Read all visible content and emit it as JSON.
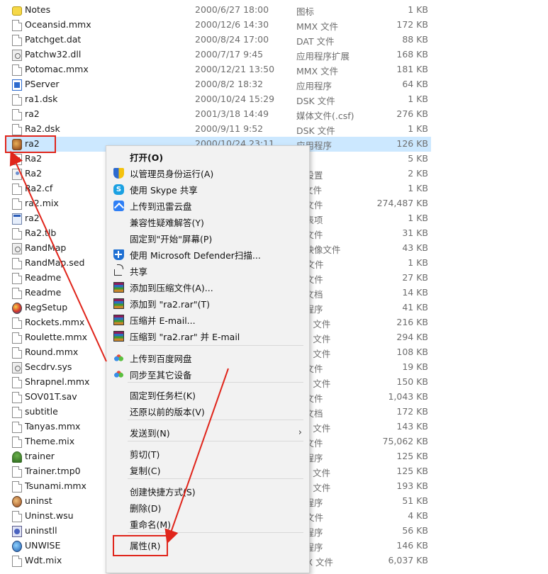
{
  "files": [
    {
      "name": "Notes",
      "date": "2000/6/27 18:00",
      "type": "图标",
      "size": "1 KB",
      "icon": "note-icon"
    },
    {
      "name": "Oceansid.mmx",
      "date": "2000/12/6 14:30",
      "type": "MMX 文件",
      "size": "172 KB",
      "icon": "file-icon"
    },
    {
      "name": "Patchget.dat",
      "date": "2000/8/24 17:00",
      "type": "DAT 文件",
      "size": "88 KB",
      "icon": "file-icon"
    },
    {
      "name": "Patchw32.dll",
      "date": "2000/7/17 9:45",
      "type": "应用程序扩展",
      "size": "168 KB",
      "icon": "dll-icon"
    },
    {
      "name": "Potomac.mmx",
      "date": "2000/12/21 13:50",
      "type": "MMX 文件",
      "size": "181 KB",
      "icon": "file-icon"
    },
    {
      "name": "PServer",
      "date": "2000/8/2 18:32",
      "type": "应用程序",
      "size": "64 KB",
      "icon": "pserver-icon"
    },
    {
      "name": "ra1.dsk",
      "date": "2000/10/24 15:29",
      "type": "DSK 文件",
      "size": "1 KB",
      "icon": "file-icon"
    },
    {
      "name": "ra2",
      "date": "2001/3/18 14:49",
      "type": "媒体文件(.csf)",
      "size": "276 KB",
      "icon": "file-icon"
    },
    {
      "name": "Ra2.dsk",
      "date": "2000/9/11 9:52",
      "type": "DSK 文件",
      "size": "1 KB",
      "icon": "file-icon"
    },
    {
      "name": "ra2",
      "date": "2000/10/24 23:11",
      "type": "应用程序",
      "size": "126 KB",
      "icon": "ra2-app-icon",
      "selected": true
    },
    {
      "name": "Ra2",
      "date": "",
      "type": "标",
      "size": "5 KB",
      "icon": "ra2-icon-file"
    },
    {
      "name": "Ra2",
      "date": "",
      "type": "置设置",
      "size": "2 KB",
      "icon": "config-icon"
    },
    {
      "name": "Ra2.cf",
      "date": "",
      "type": "F 文件",
      "size": "1 KB",
      "icon": "file-icon"
    },
    {
      "name": "ra2.mix",
      "date": "",
      "type": "X 文件",
      "size": "274,487 KB",
      "icon": "file-icon"
    },
    {
      "name": "ra2",
      "date": "",
      "type": "册表项",
      "size": "1 KB",
      "icon": "registry-icon"
    },
    {
      "name": "Ra2.tlb",
      "date": "",
      "type": "B 文件",
      "size": "31 KB",
      "icon": "file-icon"
    },
    {
      "name": "RandMap",
      "date": "",
      "type": "盘映像文件",
      "size": "43 KB",
      "icon": "disk-image-icon"
    },
    {
      "name": "RandMap.sed",
      "date": "",
      "type": "D 文件",
      "size": "1 KB",
      "icon": "file-icon"
    },
    {
      "name": "Readme",
      "date": "",
      "type": "C 文件",
      "size": "27 KB",
      "icon": "file-icon"
    },
    {
      "name": "Readme",
      "date": "",
      "type": "本文档",
      "size": "14 KB",
      "icon": "file-icon"
    },
    {
      "name": "RegSetup",
      "date": "",
      "type": "用程序",
      "size": "41 KB",
      "icon": "regsetup-icon"
    },
    {
      "name": "Rockets.mmx",
      "date": "",
      "type": "MX 文件",
      "size": "216 KB",
      "icon": "file-icon"
    },
    {
      "name": "Roulette.mmx",
      "date": "",
      "type": "MX 文件",
      "size": "294 KB",
      "icon": "file-icon"
    },
    {
      "name": "Round.mmx",
      "date": "",
      "type": "MX 文件",
      "size": "108 KB",
      "icon": "file-icon"
    },
    {
      "name": "Secdrv.sys",
      "date": "",
      "type": "统文件",
      "size": "19 KB",
      "icon": "sys-icon"
    },
    {
      "name": "Shrapnel.mmx",
      "date": "",
      "type": "MX 文件",
      "size": "150 KB",
      "icon": "file-icon"
    },
    {
      "name": "SOV01T.sav",
      "date": "",
      "type": "V 文件",
      "size": "1,043 KB",
      "icon": "file-icon"
    },
    {
      "name": "subtitle",
      "date": "",
      "type": "本文档",
      "size": "172 KB",
      "icon": "file-icon"
    },
    {
      "name": "Tanyas.mmx",
      "date": "",
      "type": "MX 文件",
      "size": "143 KB",
      "icon": "file-icon"
    },
    {
      "name": "Theme.mix",
      "date": "",
      "type": "X 文件",
      "size": "75,062 KB",
      "icon": "file-icon"
    },
    {
      "name": "trainer",
      "date": "",
      "type": "用程序",
      "size": "125 KB",
      "icon": "trainer-icon"
    },
    {
      "name": "Trainer.tmp0",
      "date": "",
      "type": "IP0 文件",
      "size": "125 KB",
      "icon": "file-icon"
    },
    {
      "name": "Tsunami.mmx",
      "date": "",
      "type": "MX 文件",
      "size": "193 KB",
      "icon": "file-icon"
    },
    {
      "name": "uninst",
      "date": "",
      "type": "用程序",
      "size": "51 KB",
      "icon": "uninst-icon"
    },
    {
      "name": "Uninst.wsu",
      "date": "",
      "type": "U 文件",
      "size": "4 KB",
      "icon": "file-icon"
    },
    {
      "name": "uninstll",
      "date": "",
      "type": "用程序",
      "size": "56 KB",
      "icon": "uninstll-icon"
    },
    {
      "name": "UNWISE",
      "date": "",
      "type": "用程序",
      "size": "146 KB",
      "icon": "unwise-icon"
    },
    {
      "name": "Wdt.mix",
      "date": "2000/10/1 18:54",
      "type": "MIX 文件",
      "size": "6,037 KB",
      "icon": "file-icon"
    }
  ],
  "context_menu": {
    "items": [
      {
        "label": "打开(O)",
        "icon": "",
        "bold": true
      },
      {
        "label": "以管理员身份运行(A)",
        "icon": "admin-shield-icon"
      },
      {
        "label": "使用 Skype 共享",
        "icon": "skype-icon"
      },
      {
        "label": "上传到迅雷云盘",
        "icon": "xunlei-cloud-icon"
      },
      {
        "label": "兼容性疑难解答(Y)",
        "icon": ""
      },
      {
        "label": "固定到\"开始\"屏幕(P)",
        "icon": ""
      },
      {
        "label": "使用 Microsoft Defender扫描...",
        "icon": "defender-icon"
      },
      {
        "label": "共享",
        "icon": "share-icon"
      },
      {
        "label": "添加到压缩文件(A)...",
        "icon": "winrar-icon"
      },
      {
        "label": "添加到 \"ra2.rar\"(T)",
        "icon": "winrar-icon"
      },
      {
        "label": "压缩并 E-mail...",
        "icon": "winrar-icon"
      },
      {
        "label": "压缩到 \"ra2.rar\" 并 E-mail",
        "icon": "winrar-icon"
      },
      {
        "label": "上传到百度网盘",
        "icon": "baidu-netdisk-icon"
      },
      {
        "label": "同步至其它设备",
        "icon": "baidu-netdisk-icon"
      },
      {
        "label": "固定到任务栏(K)",
        "icon": ""
      },
      {
        "label": "还原以前的版本(V)",
        "icon": ""
      },
      {
        "label": "发送到(N)",
        "icon": "",
        "submenu": true
      },
      {
        "label": "剪切(T)",
        "icon": ""
      },
      {
        "label": "复制(C)",
        "icon": ""
      },
      {
        "label": "创建快捷方式(S)",
        "icon": ""
      },
      {
        "label": "删除(D)",
        "icon": ""
      },
      {
        "label": "重命名(M)",
        "icon": ""
      },
      {
        "label": "属性(R)",
        "icon": "",
        "highlighted": true
      }
    ],
    "submenu_glyph": "›"
  },
  "annotation_color": "#e0251b",
  "selection_color": "#cce8ff"
}
